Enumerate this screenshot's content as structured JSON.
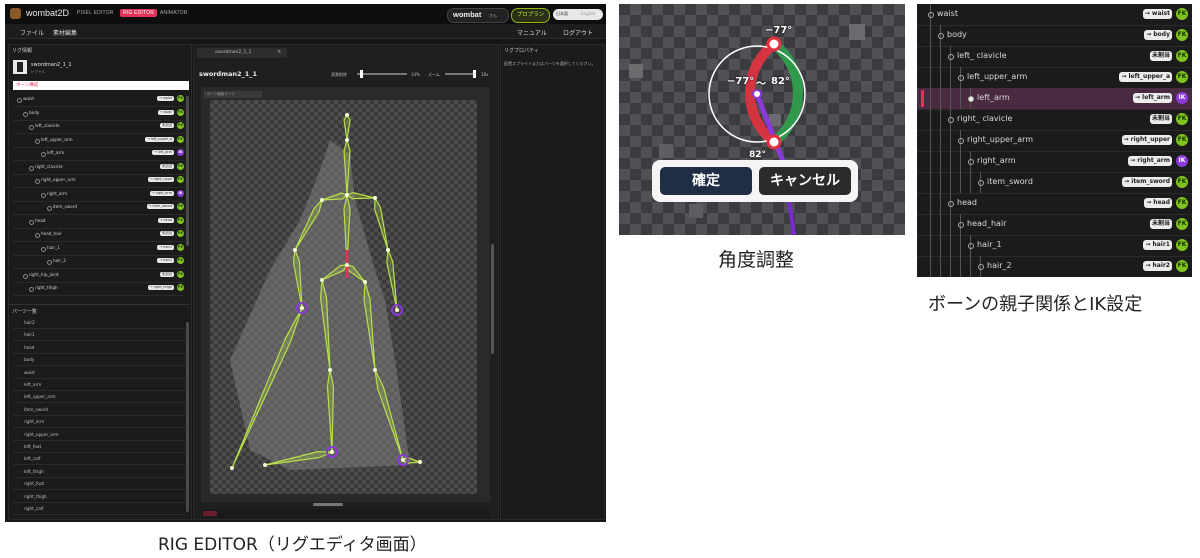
{
  "rig_editor": {
    "app_title": "wombat2D",
    "nav_tabs": [
      "PIXEL EDITOR",
      "RIG EDITOR",
      "ANIMATOR"
    ],
    "user_name": "wombat",
    "user_suffix": "さん",
    "pro_plan": "プロプラン",
    "lang_selected": "日本語",
    "lang_other": "English",
    "menu_left": [
      "ファイル",
      "素材編集"
    ],
    "menu_right": [
      "マニュアル",
      "ログアウト"
    ],
    "rig_panel_title": "リグ情報",
    "rig_name": "swordman2_1_1",
    "rig_sub": "ピクセル",
    "bone_section": "ボーン構成",
    "bones": [
      {
        "name": "waist",
        "tag": "→ waist",
        "kind": "FK",
        "depth": 0
      },
      {
        "name": "body",
        "tag": "→ body",
        "kind": "FK",
        "depth": 1
      },
      {
        "name": "left_clavicle",
        "tag": "未割当",
        "kind": "FK",
        "depth": 2
      },
      {
        "name": "left_upper_arm",
        "tag": "→ left_upper_a",
        "kind": "FK",
        "depth": 3
      },
      {
        "name": "left_arm",
        "tag": "→ left_arm",
        "kind": "IK",
        "depth": 4
      },
      {
        "name": "right_clavicle",
        "tag": "未割当",
        "kind": "FK",
        "depth": 2
      },
      {
        "name": "right_upper_arm",
        "tag": "→ right_uppe",
        "kind": "FK",
        "depth": 3
      },
      {
        "name": "right_arm",
        "tag": "→ right_arm",
        "kind": "IK",
        "depth": 4
      },
      {
        "name": "item_sword",
        "tag": "→ item_sword",
        "kind": "FK",
        "depth": 5
      },
      {
        "name": "head",
        "tag": "→ head",
        "kind": "FK",
        "depth": 2
      },
      {
        "name": "head_hair",
        "tag": "未割当",
        "kind": "FK",
        "depth": 3
      },
      {
        "name": "hair_1",
        "tag": "→ hair1",
        "kind": "FK",
        "depth": 4
      },
      {
        "name": "hair_2",
        "tag": "→ hair2",
        "kind": "FK",
        "depth": 5
      },
      {
        "name": "right_hip_joint",
        "tag": "未割当",
        "kind": "FK",
        "depth": 1
      },
      {
        "name": "right_thigh",
        "tag": "→ right_thigh",
        "kind": "FK",
        "depth": 2
      }
    ],
    "parts_title": "パーツ一覧",
    "parts": [
      "hair2",
      "hair1",
      "head",
      "body",
      "waist",
      "left_arm",
      "left_upper_arm",
      "item_sword",
      "right_arm",
      "right_upper_arm",
      "left_foot",
      "left_calf",
      "left_thigh",
      "right_foot",
      "right_thigh",
      "right_calf"
    ],
    "canvas_tab": "swordman2_1_1",
    "canvas_title": "swordman2_1_1",
    "bg_label": "背景削除",
    "bg_value": "14%",
    "zoom_label": "ズーム",
    "zoom_value": "18x",
    "canvas_hint": "ボーン編集モード",
    "props_title": "リグプロパティ",
    "props_hint": "配置スプライトまたはパーツを選択してください。"
  },
  "angle_adjust": {
    "top_angle": "−77°",
    "left_angle": "−77°",
    "tilde": "〜",
    "right_angle": "82°",
    "bottom_angle": "82°",
    "confirm": "確定",
    "cancel": "キャンセル"
  },
  "hierarchy": {
    "rows": [
      {
        "name": "waist",
        "tag": "→ waist",
        "kind": "FK",
        "depth": 0,
        "selected": false
      },
      {
        "name": "body",
        "tag": "→ body",
        "kind": "FK",
        "depth": 1,
        "selected": false
      },
      {
        "name": "left_ clavicle",
        "tag": "未割当",
        "kind": "FK",
        "depth": 2,
        "selected": false
      },
      {
        "name": "left_upper_arm",
        "tag": "→ left_upper_a",
        "kind": "FK",
        "depth": 3,
        "selected": false
      },
      {
        "name": "left_arm",
        "tag": "→ left_arm",
        "kind": "IK",
        "depth": 4,
        "selected": true
      },
      {
        "name": "right_ clavicle",
        "tag": "未割当",
        "kind": "FK",
        "depth": 2,
        "selected": false
      },
      {
        "name": "right_upper_arm",
        "tag": "→ right_upper",
        "kind": "FK",
        "depth": 3,
        "selected": false
      },
      {
        "name": "right_arm",
        "tag": "→ right_arm",
        "kind": "IK",
        "depth": 4,
        "selected": false
      },
      {
        "name": "item_sword",
        "tag": "→ item_sword",
        "kind": "FK",
        "depth": 5,
        "selected": false
      },
      {
        "name": "head",
        "tag": "→ head",
        "kind": "FK",
        "depth": 2,
        "selected": false
      },
      {
        "name": "head_hair",
        "tag": "未割当",
        "kind": "FK",
        "depth": 3,
        "selected": false
      },
      {
        "name": "hair_1",
        "tag": "→ hair1",
        "kind": "FK",
        "depth": 4,
        "selected": false
      },
      {
        "name": "hair_2",
        "tag": "→ hair2",
        "kind": "FK",
        "depth": 5,
        "selected": false
      }
    ]
  },
  "captions": {
    "rig": "RIG EDITOR（リグエディタ画面）",
    "angle": "角度調整",
    "hierarchy": "ボーンの親子関係とIK設定"
  },
  "colors": {
    "accent_pink": "#e0335c",
    "fk_green": "#7fc31f",
    "ik_purple": "#8a3ad8",
    "bone_yellow": "#b8e04a"
  }
}
